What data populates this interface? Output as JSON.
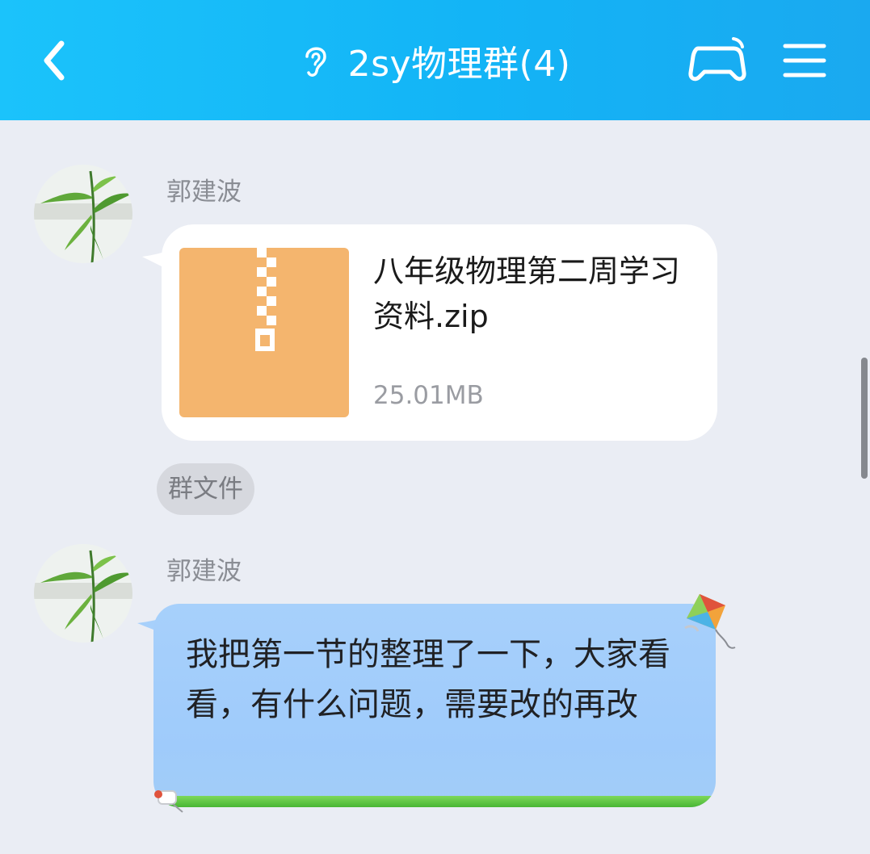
{
  "header": {
    "title": "2sy物理群(4)",
    "back_icon": "chevron-left-icon",
    "ear_icon": "ear-icon",
    "game_icon": "gamepad-icon",
    "menu_icon": "menu-icon"
  },
  "messages": [
    {
      "sender": "郭建波",
      "type": "file",
      "file_name": "八年级物理第二周学习资料.zip",
      "file_size": "25.01MB",
      "tag": "群文件"
    },
    {
      "sender": "郭建波",
      "type": "text",
      "text": "我把第一节的整理了一下，大家看看，有什么问题，需要改的再改"
    }
  ],
  "colors": {
    "header": "#13b4f6",
    "background": "#eaedf4",
    "zip_tile": "#f4b56e",
    "text_bubble": "#a7d0fb"
  }
}
